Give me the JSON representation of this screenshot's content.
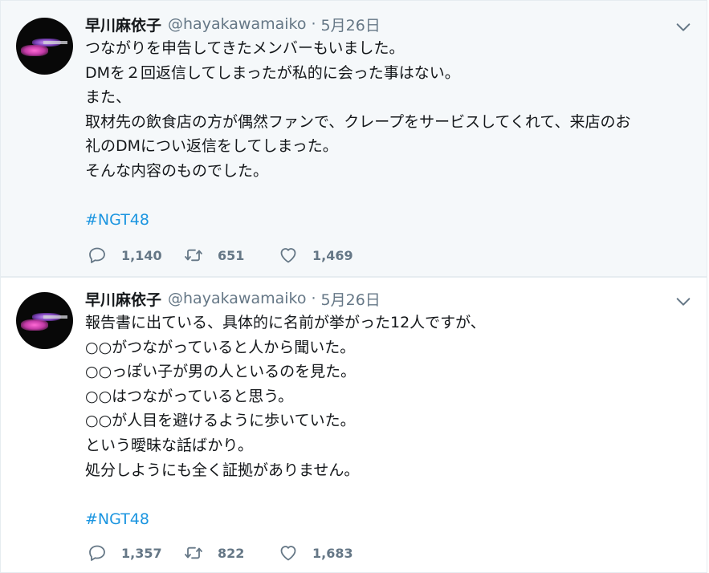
{
  "tweets": [
    {
      "author": "早川麻依子",
      "handle": "@hayakawamaiko",
      "separator": "·",
      "date": "5月26日",
      "lines": [
        "つながりを申告してきたメンバーもいました。",
        "DMを２回返信してしまったが私的に会った事はない。",
        "また、",
        "取材先の飲食店の方が偶然ファンで、クレープをサービスしてくれて、来店のお",
        "礼のDMについ返信をしてしまった。",
        "そんな内容のものでした。"
      ],
      "hashtag": "#NGT48",
      "replies": "1,140",
      "retweets": "651",
      "likes": "1,469"
    },
    {
      "author": "早川麻依子",
      "handle": "@hayakawamaiko",
      "separator": "·",
      "date": "5月26日",
      "lines": [
        "報告書に出ている、具体的に名前が挙がった12人ですが、",
        "○○がつながっていると人から聞いた。",
        "○○っぽい子が男の人といるのを見た。",
        "○○はつながっていると思う。",
        "○○が人目を避けるように歩いていた。",
        "という曖昧な話ばかり。",
        "処分しようにも全く証拠がありません。"
      ],
      "hashtag": "#NGT48",
      "replies": "1,357",
      "retweets": "822",
      "likes": "1,683"
    }
  ],
  "icons": {
    "reply": "reply-icon",
    "retweet": "retweet-icon",
    "like": "heart-icon",
    "caret": "chevron-down-icon"
  },
  "colors": {
    "handle": "#657786",
    "hashtag": "#1b95e0",
    "tweet_bg_highlight": "#f5f8fa"
  }
}
